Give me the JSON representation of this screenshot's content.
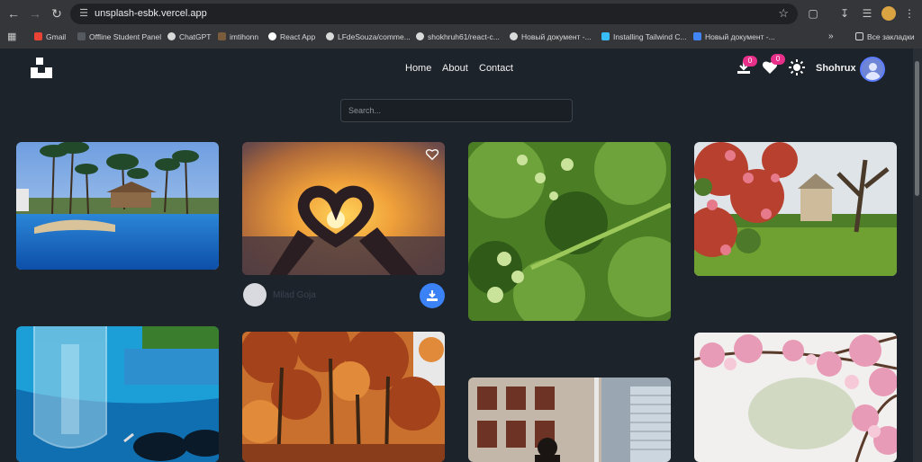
{
  "browser": {
    "url": "unsplash-esbk.vercel.app",
    "bookmarks": [
      {
        "label": "Gmail",
        "color": "#ea4335"
      },
      {
        "label": "Offline Student Panel",
        "color": "#444950"
      },
      {
        "label": "ChatGPT",
        "color": "#d9d9d9"
      },
      {
        "label": "imtihonn",
        "color": "#7a5c3c"
      },
      {
        "label": "React App",
        "color": "#ffffff"
      },
      {
        "label": "LFdeSouza/comme...",
        "color": "#d9d9d9"
      },
      {
        "label": "shokhruh61/react-c...",
        "color": "#d9d9d9"
      },
      {
        "label": "Новый документ -...",
        "color": "#d9d9d9"
      },
      {
        "label": "Installing Tailwind C...",
        "color": "#38bdf8"
      },
      {
        "label": "Новый документ -...",
        "color": "#4285f4"
      }
    ],
    "other_bookmarks": "Все закладки"
  },
  "header": {
    "nav": [
      "Home",
      "About",
      "Contact"
    ],
    "downloads_count": "0",
    "likes_count": "0",
    "username": "Shohrux"
  },
  "search": {
    "placeholder": "Search..."
  },
  "card_author": {
    "name": "Milad Goja"
  },
  "colors": {
    "accent": "#3b82f6",
    "badge": "#e8308a",
    "page_bg": "#1d232a"
  }
}
